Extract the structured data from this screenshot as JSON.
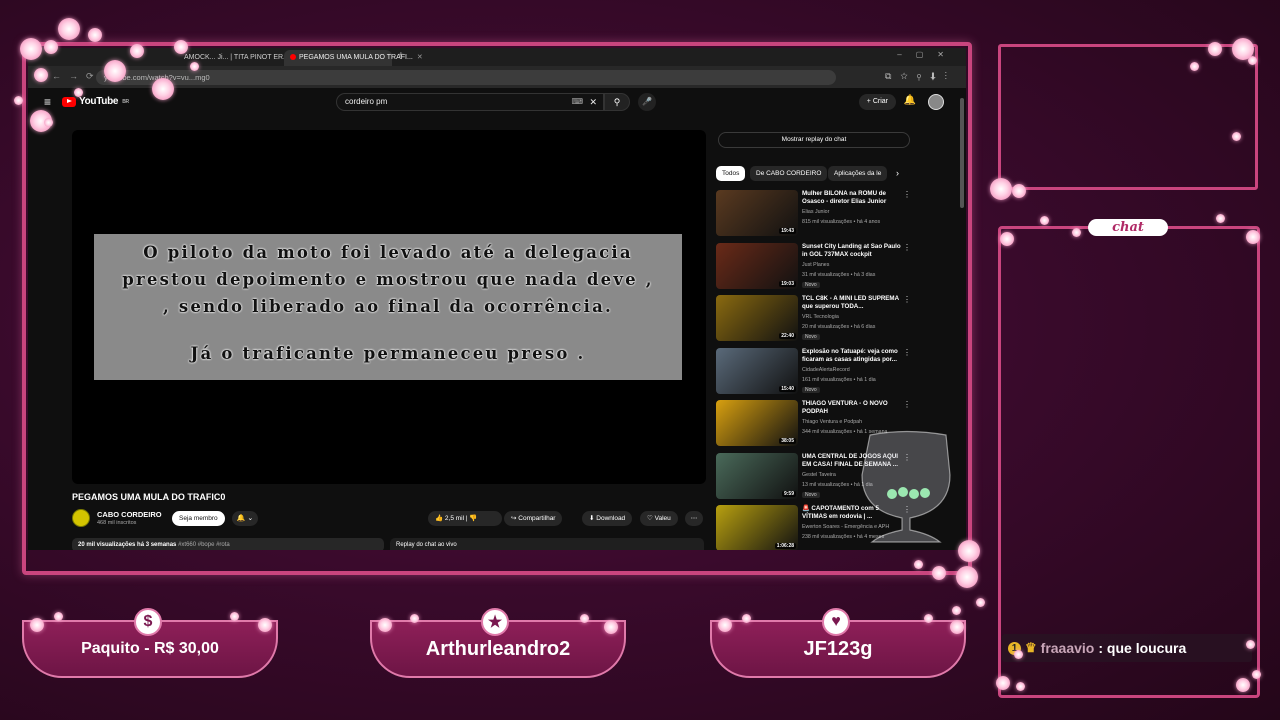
{
  "browser": {
    "tabs": [
      {
        "label": "AMOCK... Ji... | TITA PINOT ER..."
      },
      {
        "label": "PEGAMOS UMA MULA DO TRAFI..."
      }
    ],
    "url": "youtube.com/watch?v=vu...mg0",
    "new_tab_label": "+"
  },
  "youtube": {
    "logo_text": "YouTube",
    "country": "BR",
    "search_value": "cordeiro pm",
    "create_label": "Criar",
    "caption_lines": [
      "O piloto da moto foi levado até a delegacia",
      "prestou depoimento e mostrou que nada deve ,",
      ", sendo liberado ao final da ocorrência.",
      "Já o traficante permaneceu preso ."
    ],
    "video_title": "PEGAMOS UMA MULA DO TRAFIC0",
    "channel_name": "CABO CORDEIRO",
    "channel_subs": "468 mil inscritos",
    "join_label": "Seja membro",
    "likes": "2,5 mil",
    "share_label": "Compartilhar",
    "download_label": "Download",
    "thanks_label": "Valeu",
    "desc_stats": "20 mil visualizações  há 3 semanas",
    "desc_tags": "#xt660 #bope #rota",
    "replay_label": "Replay do chat ao vivo",
    "show_chat_label": "Mostrar replay do chat",
    "chips": [
      "Todos",
      "De CABO CORDEIRO",
      "Aplicações da le"
    ],
    "recommendations": [
      {
        "title": "Mulher BILONA na ROMU de Osasco - diretor Elias Junior",
        "channel": "Elias Junior",
        "meta": "815 mil visualizações • há 4 anos",
        "duration": "19:43",
        "new": "",
        "thumb_color": "#5a3a20"
      },
      {
        "title": "Sunset City Landing at Sao Paulo in GOL 737MAX cockpit",
        "channel": "Just Planes",
        "meta": "31 mil visualizações • há 3 dias",
        "duration": "19:03",
        "new": "Novo",
        "thumb_color": "#6a2a18"
      },
      {
        "title": "TCL C8K - A MINI LED SUPREMA que superou TODA...",
        "channel": "VRL Tecnologia",
        "meta": "20 mil visualizações • há 6 dias",
        "duration": "22:40",
        "new": "Novo",
        "thumb_color": "#8a6a10"
      },
      {
        "title": "Explosão no Tatuapé: veja como ficaram as casas atingidas por...",
        "channel": "CidadeAlertaRecord",
        "meta": "161 mil visualizações • há 1 dia",
        "duration": "15:40",
        "new": "Novo",
        "thumb_color": "#5a6a7a"
      },
      {
        "title": "THIAGO VENTURA - O NOVO PODPAH",
        "channel": "Thiago Ventura e Podpah",
        "meta": "344 mil visualizações • há 1 semana",
        "duration": "38:05",
        "new": "",
        "thumb_color": "#d8a010"
      },
      {
        "title": "UMA CENTRAL DE JOGOS AQUI EM CASA! FINAL DE SEMANA ...",
        "channel": "Gestel Taveira",
        "meta": "13 mil visualizações • há 1 dia",
        "duration": "9:59",
        "new": "Novo",
        "thumb_color": "#4a6a5a"
      },
      {
        "title": "🚨 CAPOTAMENTO com 5 VÍTIMAS em rodovia | ...",
        "channel": "Ewerton Soares - Emergência e APH",
        "meta": "238 mil visualizações • há 4 meses",
        "duration": "1:06:28",
        "new": "",
        "thumb_color": "#b8a010"
      }
    ]
  },
  "overlay": {
    "chat_tab_label": "chat",
    "chat_message": {
      "user": "fraaavio",
      "text": ": que loucura",
      "badge_number": "1"
    },
    "alerts": [
      {
        "label": "Paquito - R$ 30,00",
        "icon": "$"
      },
      {
        "label": "Arthurleandro2",
        "icon": "★"
      },
      {
        "label": "JF123g",
        "icon": "♥"
      }
    ],
    "accent_color": "#c9457e"
  }
}
